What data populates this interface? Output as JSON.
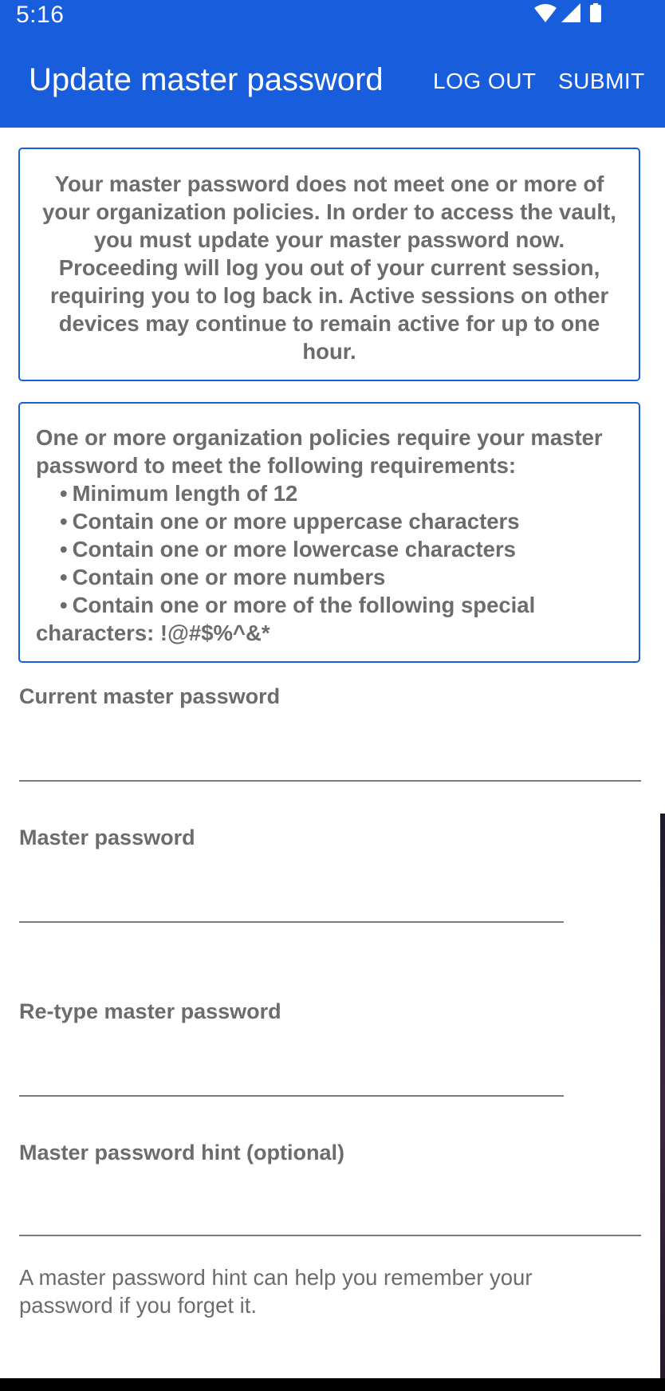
{
  "status_bar": {
    "time": "5:16",
    "icons": [
      "wifi-icon",
      "signal-icon",
      "battery-icon"
    ]
  },
  "app_bar": {
    "title": "Update master password",
    "log_out_label": "LOG OUT",
    "submit_label": "SUBMIT",
    "background_color": "#175ddc"
  },
  "notice": {
    "text": "Your master password does not meet one or more of your organization policies. In order to access the vault, you must update your master password now. Proceeding will log you out of your current session, requiring you to log back in. Active sessions on other devices may continue to remain active for up to one hour."
  },
  "policy": {
    "intro": "One or more organization policies require your master password to meet the following requirements:",
    "requirements": [
      "Minimum length of 12",
      "Contain one or more uppercase characters",
      "Contain one or more lowercase characters",
      "Contain one or more numbers",
      "Contain one or more of the following special characters: !@#$%^&*"
    ]
  },
  "form": {
    "current_password_label": "Current master password",
    "current_password_value": "",
    "master_password_label": "Master password",
    "master_password_value": "",
    "retype_password_label": "Re-type master password",
    "retype_password_value": "",
    "hint_label": "Master password hint (optional)",
    "hint_value": "",
    "hint_helper": "A master password hint can help you remember your password if you forget it."
  }
}
